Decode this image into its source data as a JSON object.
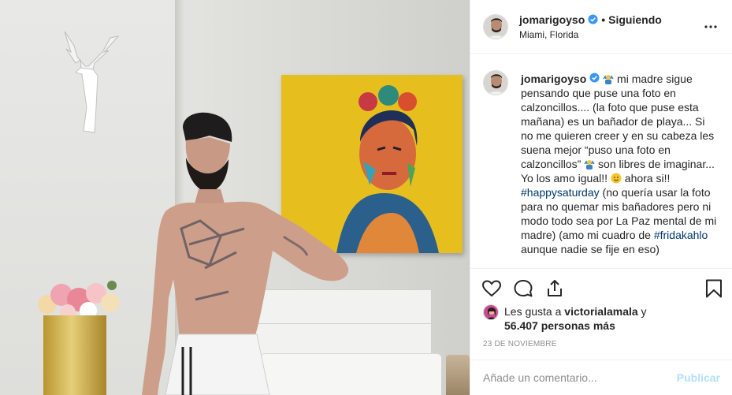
{
  "post": {
    "username": "jomarigoyso",
    "follow_status": "Siguiendo",
    "separator": "•",
    "location": "Miami, Florida",
    "photo_alt": "post-photo"
  },
  "caption": {
    "username": "jomarigoyso",
    "part1": " mi madre sigue pensando que puse una foto en calzoncillos.... (la foto que puse esta mañana) es un bañador de playa... Si no me quieren creer y en su cabeza les suena mejor “puso una foto en calzoncillos” ",
    "part2": " son libres de imaginar... Yo los amo igual!! ",
    "part3": " ahora si!! ",
    "hashtag1": "#happysaturday",
    "part4": " (no quería usar la foto para no quemar mis bañadores pero ni modo todo sea por La Paz mental de mi madre) (amo mi cuadro de ",
    "hashtag2": "#fridakahlo",
    "part5": " aunque nadie se fije en eso)"
  },
  "likes": {
    "prefix": "Les gusta a ",
    "user": "victorialamala",
    "conj": " y",
    "count": "56.407 personas más"
  },
  "date": "23 DE NOVIEMBRE",
  "comment": {
    "placeholder": "Añade un comentario...",
    "publish_label": "Publicar"
  },
  "icons": {
    "like": "heart-icon",
    "comment": "comment-icon",
    "share": "share-icon",
    "save": "bookmark-icon",
    "more": "more-options-icon",
    "verified": "verified-badge-icon"
  },
  "colors": {
    "link": "#00376b",
    "verified": "#3897f0",
    "publish_disabled": "#b2dffc"
  }
}
